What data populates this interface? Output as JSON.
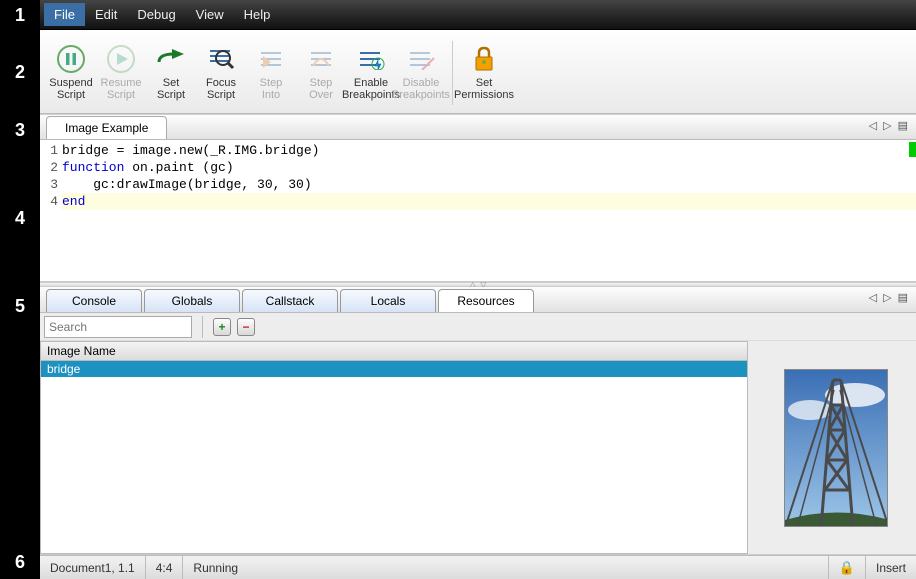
{
  "menu": {
    "items": [
      "File",
      "Edit",
      "Debug",
      "View",
      "Help"
    ],
    "active_index": 0
  },
  "toolbar": {
    "buttons": [
      {
        "label": "Suspend\nScript",
        "disabled": false
      },
      {
        "label": "Resume\nScript",
        "disabled": true
      },
      {
        "label": "Set\nScript",
        "disabled": false
      },
      {
        "label": "Focus\nScript",
        "disabled": false
      },
      {
        "label": "Step\nInto",
        "disabled": true
      },
      {
        "label": "Step\nOver",
        "disabled": true
      },
      {
        "label": "Enable\nBreakpoints",
        "disabled": false
      },
      {
        "label": "Disable\nBreakpoints",
        "disabled": true
      },
      {
        "label": "Set\nPermissions",
        "disabled": false
      }
    ]
  },
  "editor": {
    "tab_label": "Image Example",
    "lines": [
      {
        "n": "1",
        "prefix": "bridge = image.new(_R.IMG.bridge)",
        "kw": "",
        "suffix": ""
      },
      {
        "n": "2",
        "prefix": "",
        "kw": "function",
        "suffix": " on.paint (gc)"
      },
      {
        "n": "3",
        "prefix": "    gc:drawImage(bridge, 30, 30)",
        "kw": "",
        "suffix": ""
      },
      {
        "n": "4",
        "prefix": "",
        "kw": "end",
        "suffix": ""
      }
    ],
    "highlight_line_index": 3
  },
  "bottom_tabs": {
    "items": [
      "Console",
      "Globals",
      "Callstack",
      "Locals",
      "Resources"
    ],
    "active_index": 4
  },
  "resources": {
    "search_placeholder": "Search",
    "header": "Image Name",
    "items": [
      "bridge"
    ],
    "selected_index": 0
  },
  "status": {
    "doc": "Document1, 1.1",
    "pos": "4:4",
    "state": "Running",
    "mode": "Insert"
  },
  "gutter_labels": [
    "1",
    "2",
    "3",
    "4",
    "5",
    "6"
  ]
}
